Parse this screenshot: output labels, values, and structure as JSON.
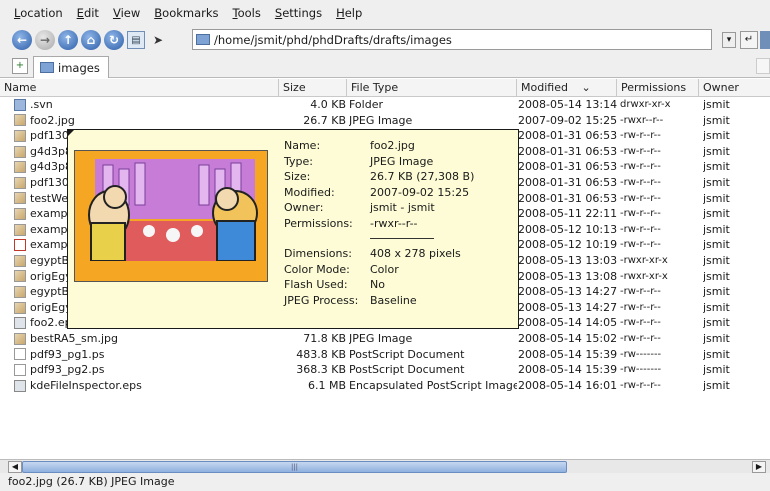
{
  "menubar": {
    "items": [
      {
        "pre": "",
        "acc": "L",
        "post": "ocation"
      },
      {
        "pre": "",
        "acc": "E",
        "post": "dit"
      },
      {
        "pre": "",
        "acc": "V",
        "post": "iew"
      },
      {
        "pre": "",
        "acc": "B",
        "post": "ookmarks"
      },
      {
        "pre": "",
        "acc": "T",
        "post": "ools"
      },
      {
        "pre": "",
        "acc": "S",
        "post": "ettings"
      },
      {
        "pre": "",
        "acc": "H",
        "post": "elp"
      }
    ]
  },
  "toolbar": {
    "location": "/home/jsmit/phd/phdDrafts/drafts/images",
    "icons": [
      "back-icon",
      "forward-icon",
      "up-icon",
      "home-icon",
      "reload-icon",
      "view-icon"
    ]
  },
  "tabs": [
    {
      "label": "images"
    }
  ],
  "columns": [
    "Name",
    "Size",
    "File Type",
    "Modified",
    "Permissions",
    "Owner"
  ],
  "sort_indicator": "⌄",
  "files": [
    {
      "icon": "folder",
      "name": ".svn",
      "size": "4.0 KB",
      "type": "Folder",
      "modified": "2008-05-14 13:14",
      "perm": "drwxr-xr-x",
      "owner": "jsmit"
    },
    {
      "icon": "img",
      "name": "foo2.jpg",
      "size": "26.7 KB",
      "type": "JPEG Image",
      "modified": "2007-09-02 15:25",
      "perm": "-rwxr--r--",
      "owner": "jsmit"
    },
    {
      "icon": "img",
      "name": "pdf130.",
      "size": "",
      "type": "",
      "modified": "2008-01-31 06:53",
      "perm": "-rw-r--r--",
      "owner": "jsmit"
    },
    {
      "icon": "img",
      "name": "g4d3p8",
      "size": "",
      "type": "age",
      "modified": "2008-01-31 06:53",
      "perm": "-rw-r--r--",
      "owner": "jsmit"
    },
    {
      "icon": "img",
      "name": "g4d3p8",
      "size": "",
      "type": "",
      "modified": "2008-01-31 06:53",
      "perm": "-rw-r--r--",
      "owner": "jsmit"
    },
    {
      "icon": "img",
      "name": "pdf130.",
      "size": "",
      "type": "age",
      "modified": "2008-01-31 06:53",
      "perm": "-rw-r--r--",
      "owner": "jsmit"
    },
    {
      "icon": "img",
      "name": "testWel",
      "size": "",
      "type": "age",
      "modified": "2008-01-31 06:53",
      "perm": "-rw-r--r--",
      "owner": "jsmit"
    },
    {
      "icon": "img",
      "name": "exampl",
      "size": "",
      "type": "age",
      "modified": "2008-05-11 22:11",
      "perm": "-rw-r--r--",
      "owner": "jsmit"
    },
    {
      "icon": "img",
      "name": "exampl",
      "size": "",
      "type": "",
      "modified": "2008-05-12 10:13",
      "perm": "-rw-r--r--",
      "owner": "jsmit"
    },
    {
      "icon": "pdf",
      "name": "exampl",
      "size": "",
      "type": "",
      "modified": "2008-05-12 10:19",
      "perm": "-rw-r--r--",
      "owner": "jsmit"
    },
    {
      "icon": "img",
      "name": "egyptBl",
      "size": "",
      "type": "",
      "modified": "2008-05-13 13:03",
      "perm": "-rwxr-xr-x",
      "owner": "jsmit"
    },
    {
      "icon": "img",
      "name": "origEgy",
      "size": "",
      "type": "",
      "modified": "2008-05-13 13:08",
      "perm": "-rwxr-xr-x",
      "owner": "jsmit"
    },
    {
      "icon": "img",
      "name": "egyptBl",
      "size": "",
      "type": "age",
      "modified": "2008-05-13 14:27",
      "perm": "-rw-r--r--",
      "owner": "jsmit"
    },
    {
      "icon": "img",
      "name": "origEgy",
      "size": "",
      "type": "age",
      "modified": "2008-05-13 14:27",
      "perm": "-rw-r--r--",
      "owner": "jsmit"
    },
    {
      "icon": "eps",
      "name": "foo2.eps",
      "size": "679.4 KB",
      "type": "Encapsulated PostScript Image",
      "modified": "2008-05-14 14:05",
      "perm": "-rw-r--r--",
      "owner": "jsmit"
    },
    {
      "icon": "img",
      "name": "bestRA5_sm.jpg",
      "size": "71.8 KB",
      "type": "JPEG Image",
      "modified": "2008-05-14 15:02",
      "perm": "-rw-r--r--",
      "owner": "jsmit"
    },
    {
      "icon": "ps",
      "name": "pdf93_pg1.ps",
      "size": "483.8 KB",
      "type": "PostScript Document",
      "modified": "2008-05-14 15:39",
      "perm": "-rw-------",
      "owner": "jsmit"
    },
    {
      "icon": "ps",
      "name": "pdf93_pg2.ps",
      "size": "368.3 KB",
      "type": "PostScript Document",
      "modified": "2008-05-14 15:39",
      "perm": "-rw-------",
      "owner": "jsmit"
    },
    {
      "icon": "eps",
      "name": "kdeFileInspector.eps",
      "size": "6.1 MB",
      "type": "Encapsulated PostScript Image",
      "modified": "2008-05-14 16:01",
      "perm": "-rw-r--r--",
      "owner": "jsmit"
    }
  ],
  "tooltip": {
    "rows": [
      {
        "label": "Name:",
        "value": "foo2.jpg"
      },
      {
        "label": "Type:",
        "value": "JPEG Image"
      },
      {
        "label": "Size:",
        "value": "26.7 KB (27,308 B)"
      },
      {
        "label": "Modified:",
        "value": "2007-09-02 15:25"
      },
      {
        "label": "Owner:",
        "value": "jsmit - jsmit"
      },
      {
        "label": "Permissions:",
        "value": "-rwxr--r--"
      }
    ],
    "meta": [
      {
        "label": "Dimensions:",
        "value": "408 x 278 pixels"
      },
      {
        "label": "Color Mode:",
        "value": "Color"
      },
      {
        "label": "Flash Used:",
        "value": "No"
      },
      {
        "label": "JPEG Process:",
        "value": "Baseline"
      }
    ]
  },
  "scrollbar": {
    "thumb_grip": "|||"
  },
  "statusbar": {
    "text": "foo2.jpg (26.7 KB)  JPEG Image"
  }
}
